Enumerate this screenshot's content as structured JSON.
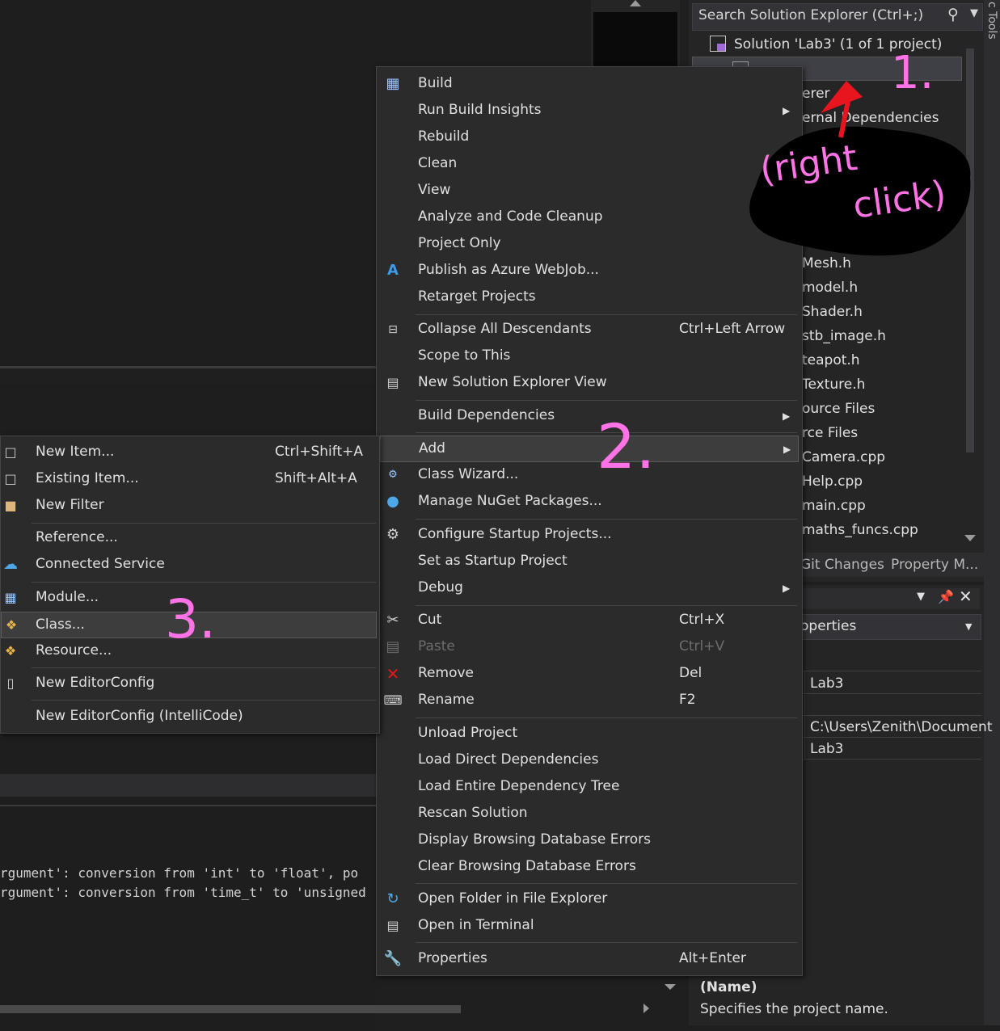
{
  "solution_explorer": {
    "search_placeholder": "Search Solution Explorer (Ctrl+;)",
    "solution_label": "Solution 'Lab3' (1 of 1 project)",
    "items": [
      {
        "label": "erer"
      },
      {
        "label": "ernal Dependencies"
      },
      {
        "label": "Mesh.h"
      },
      {
        "label": "model.h"
      },
      {
        "label": "Shader.h"
      },
      {
        "label": "stb_image.h"
      },
      {
        "label": "teapot.h"
      },
      {
        "label": "Texture.h"
      },
      {
        "label": "ource Files"
      },
      {
        "label": "rce Files"
      },
      {
        "label": "Camera.cpp"
      },
      {
        "label": "Help.cpp"
      },
      {
        "label": "main.cpp"
      },
      {
        "label": "maths_funcs.cpp"
      }
    ],
    "tabs": [
      "Git Changes",
      "Property M..."
    ]
  },
  "right_strip_label": "c Tools",
  "properties": {
    "combo_value": "operties",
    "name_value": "Lab3",
    "path_value": "C:\\Users\\Zenith\\Document",
    "lab_value": "Lab3",
    "desc_title": "(Name)",
    "desc_text": "Specifies the project name."
  },
  "output": {
    "line1": "rgument': conversion from 'int' to 'float', po",
    "line2": "rgument': conversion from 'time_t' to 'unsigned"
  },
  "context_menu": {
    "build": "Build",
    "run_build_insights": "Run Build Insights",
    "rebuild": "Rebuild",
    "clean": "Clean",
    "view": "View",
    "analyze": "Analyze and Code Cleanup",
    "project_only": "Project Only",
    "publish_azure": "Publish as Azure WebJob...",
    "retarget": "Retarget Projects",
    "collapse_all": "Collapse All Descendants",
    "collapse_all_sc": "Ctrl+Left Arrow",
    "scope_to_this": "Scope to This",
    "new_se_view": "New Solution Explorer View",
    "build_dependencies": "Build Dependencies",
    "add": "Add",
    "class_wizard": "Class Wizard...",
    "manage_nuget": "Manage NuGet Packages...",
    "configure_startup": "Configure Startup Projects...",
    "set_startup": "Set as Startup Project",
    "debug": "Debug",
    "cut": "Cut",
    "cut_sc": "Ctrl+X",
    "paste": "Paste",
    "paste_sc": "Ctrl+V",
    "remove": "Remove",
    "remove_sc": "Del",
    "rename": "Rename",
    "rename_sc": "F2",
    "unload_project": "Unload Project",
    "load_direct": "Load Direct Dependencies",
    "load_entire": "Load Entire Dependency Tree",
    "rescan": "Rescan Solution",
    "display_db_errors": "Display Browsing Database Errors",
    "clear_db_errors": "Clear Browsing Database Errors",
    "open_folder": "Open Folder in File Explorer",
    "open_terminal": "Open in Terminal",
    "properties": "Properties",
    "properties_sc": "Alt+Enter"
  },
  "add_submenu": {
    "new_item": "New Item...",
    "new_item_sc": "Ctrl+Shift+A",
    "existing_item": "Existing Item...",
    "existing_item_sc": "Shift+Alt+A",
    "new_filter": "New Filter",
    "reference": "Reference...",
    "connected_service": "Connected Service",
    "module": "Module...",
    "class": "Class...",
    "resource": "Resource...",
    "new_editorconfig": "New EditorConfig",
    "new_editorconfig_ic": "New EditorConfig (IntelliCode)"
  },
  "annotations": {
    "step1": "1.",
    "right_click_1": "(right",
    "right_click_2": "click)",
    "step2": "2.",
    "step3": "3."
  },
  "colors": {
    "annotation": "#ff73e6",
    "arrow": "#e8141e"
  }
}
